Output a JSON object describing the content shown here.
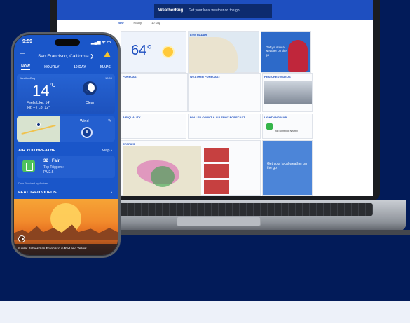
{
  "colors": {
    "background": "#021b59",
    "brand_blue": "#1a56c9",
    "lower_band": "#edf1f9",
    "aqi_green": "#4fc25d",
    "warning": "#f6c32e"
  },
  "phone": {
    "status_time": "9:59",
    "status_icons": "▂▄▆ ᯤ ▭",
    "location": "San Francisco, California ❯",
    "menu_icon": "☰",
    "tabs": [
      "NOW",
      "HOURLY",
      "10 DAY",
      "MAPS"
    ],
    "current": {
      "source": "WeatherBug",
      "time": "10:00",
      "temperature": "14",
      "unit": "°C",
      "feels_like": "Feels Like: 14°",
      "hi_lo": "Hi: -- / Lo: 12°",
      "condition": "Clear"
    },
    "map_card": {
      "wind_label": "Wind",
      "wind_value": "8",
      "edit_icon": "✎"
    },
    "air": {
      "title": "AIR YOU BREATHE",
      "map_link": "Map ›",
      "value": "32 : Fair",
      "triggers_label": "Top Triggers:",
      "trigger": "PM2.5",
      "source": "Data Provided by Ambee"
    },
    "videos": {
      "title": "FEATURED VIDEOS",
      "arrow": "›",
      "caption": "Sunset Bathes San Francisco in Red and Yellow"
    }
  },
  "laptop": {
    "banner_logo": "WeatherBug",
    "banner_cta": "Get your local weather on the go.",
    "tabs": [
      "Now",
      "Hourly",
      "10 Day"
    ],
    "current_temp": "64°",
    "panels": {
      "map": "LIVE RADAR",
      "ad_text": "Get your local weather on the go",
      "forecast": "FORECAST",
      "weather_forecast": "WEATHER FORECAST",
      "video": "FEATURED VIDEOS",
      "aqi": "AIR QUALITY",
      "pollen": "POLLEN COUNT & ALLERGY FORECAST",
      "lightning": "LIGHTNING MAP",
      "lightning_text": "No Lightning Nearby",
      "stories": "STORIES",
      "ad2_text": "Get your local weather on the go"
    }
  }
}
